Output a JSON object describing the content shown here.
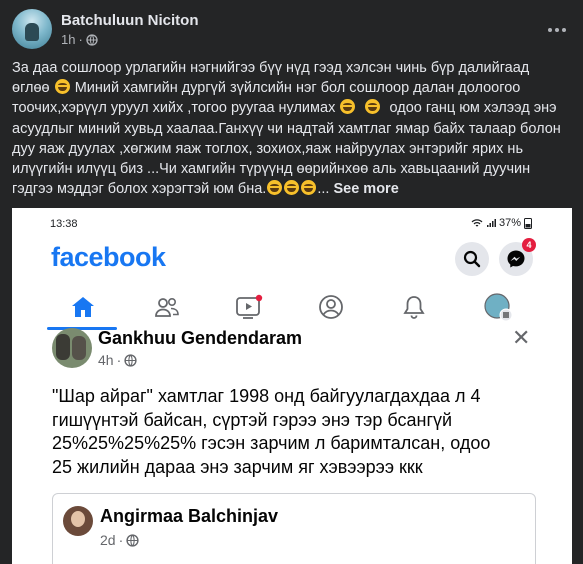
{
  "post": {
    "author": "Batchuluun Niciton",
    "time": "1h",
    "text_lines": [
      "За даа сошлоор урлагийн нэгнийгээ бүү нүд гээд хэлсэн чинь бүр далийгаад",
      "өглөө",
      "Миний хамгийн дургүй зүйлсийн нэг бол сошлоор далан долоогоо",
      "тоочих,хэрүүл уруул хийх ,тогоо руугаа нулимах",
      "одоо ганц юм хэлээд энэ",
      "асуудлыг миний хувьд хаалаа.Ганхүү чи надтай хамтлаг ямар байх талаар болон",
      "дуу яаж дуулах ,хөгжим яаж тоглох, зохиох,яаж найруулах энтэрийг ярих нь",
      "илүүгийн илүүц биз ...Чи хамгийн түрүүнд өөрийнхөө аль хавьцааний дуучин",
      "гэдгээ мэддэг болох хэрэгтэй юм бна."
    ],
    "ellipsis": "...",
    "see_more": "See more"
  },
  "screenshot": {
    "status_time": "13:38",
    "battery": "37%",
    "logo": "facebook",
    "messenger_badge": "4",
    "inner_post": {
      "author": "Gankhuu Gendendaram",
      "time": "4h",
      "text_lines": [
        "\"Шар айраг\" хамтлаг 1998 онд байгуулагдахдаа л 4",
        "гишүүнтэй байсан, сүртэй гэрээ энэ тэр бсангүй",
        "25%25%25%25% гэсэн зарчим л баримталсан, одоо",
        "25 жилийн дараа энэ зарчим яг хэвээрээ ккк"
      ]
    },
    "shared_post": {
      "author": "Angirmaa Balchinjav",
      "time": "2d"
    }
  },
  "colors": {
    "background": "#242526",
    "fb_blue": "#1877f2",
    "badge_red": "#e41e3f"
  }
}
